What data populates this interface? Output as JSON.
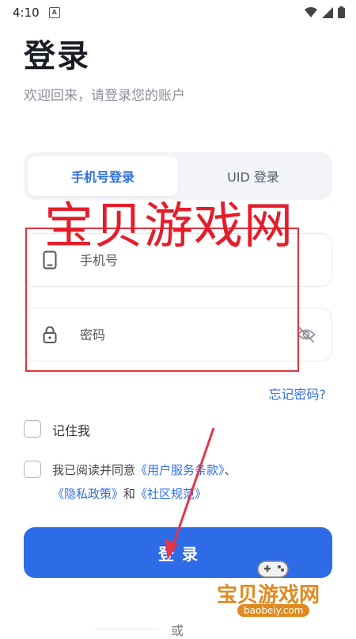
{
  "status_bar": {
    "time": "4:10",
    "notification_icon": "a-icon",
    "wifi_icon": "wifi-icon",
    "signal_icon": "signal-icon",
    "battery_icon": "battery-icon"
  },
  "header": {
    "title": "登录",
    "subtitle": "欢迎回来，请登录您的账户"
  },
  "tabs": [
    {
      "label": "手机号登录",
      "active": true
    },
    {
      "label": "UID 登录",
      "active": false
    }
  ],
  "form": {
    "phone": {
      "placeholder": "手机号",
      "value": "",
      "icon": "phone-icon"
    },
    "password": {
      "placeholder": "密码",
      "value": "",
      "icon": "lock-icon",
      "toggle_icon": "eye-off-icon"
    },
    "forgot_password": "忘记密码?",
    "remember_me": {
      "label": "记住我",
      "checked": false
    },
    "agreement": {
      "checked": false,
      "prefix": "我已阅读并同意",
      "terms_link": "《用户服务条款》",
      "sep": "、",
      "privacy_link": "《隐私政策》",
      "and": "和",
      "community_link": "《社区规范》"
    },
    "login_button": "登录",
    "or_divider": "或"
  },
  "overlay": {
    "watermark_text": "宝贝游戏网",
    "logo_text": "宝贝游戏网",
    "logo_url": "baobeiy.com"
  },
  "colors": {
    "accent": "#2e6be6",
    "link": "#2f6fe4",
    "watermark_red": "#e51d2a",
    "arrow": "#e2364a"
  }
}
